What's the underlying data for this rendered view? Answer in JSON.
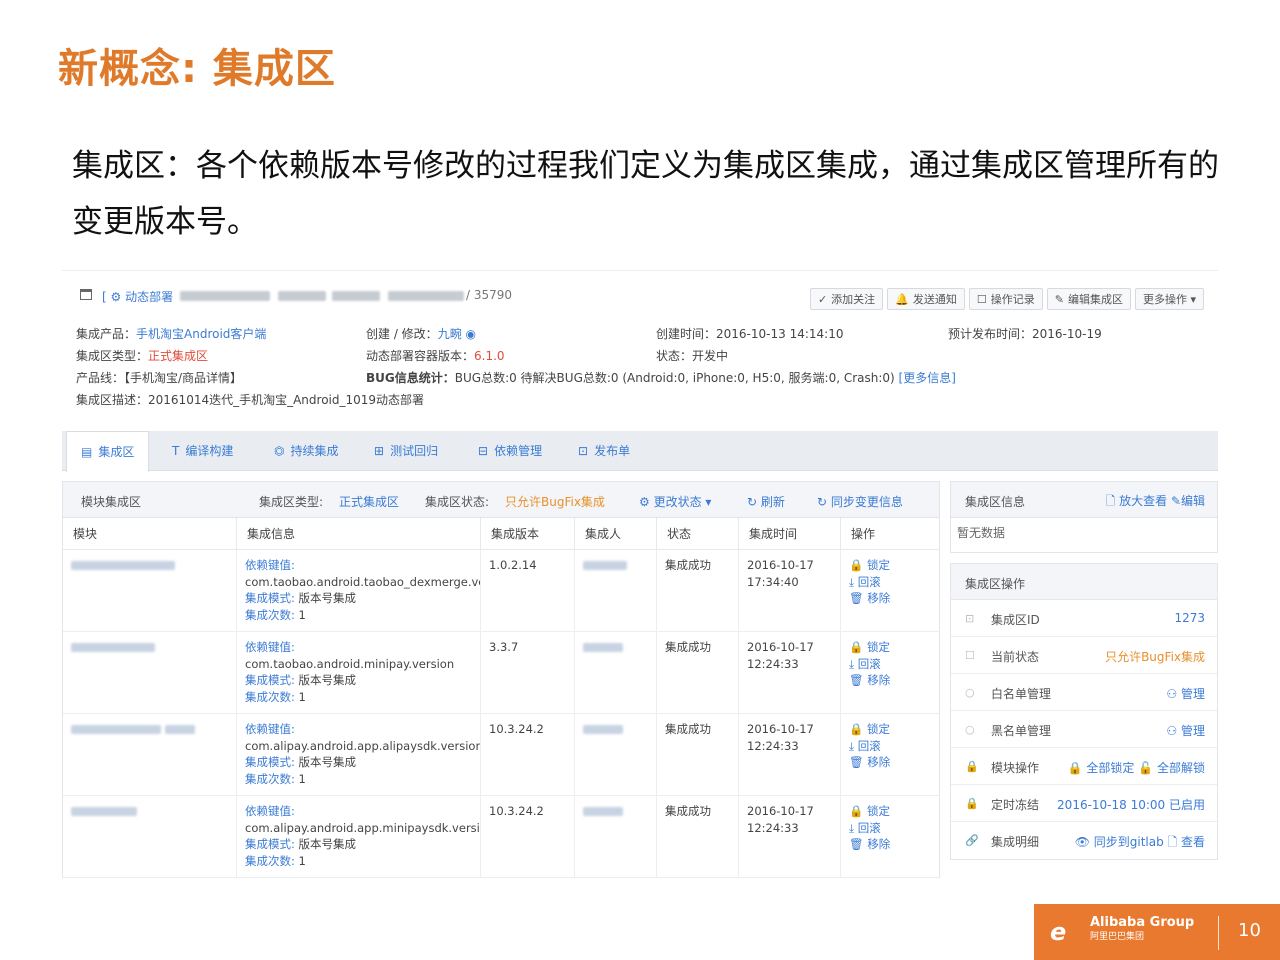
{
  "slide": {
    "title": "新概念: 集成区",
    "description": "集成区：各个依赖版本号修改的过程我们定义为集成区集成，通过集成区管理所有的变更版本号。",
    "page_number": "10",
    "brand": {
      "name": "Alibaba Group",
      "cn": "阿里巴巴集团",
      "glyph": "e"
    }
  },
  "header": {
    "breadcrumb": "[ ⚙ 动态部署",
    "id_suffix": "/ 35790",
    "buttons": [
      {
        "icon": "✓",
        "label": "添加关注"
      },
      {
        "icon": "🔔",
        "label": "发送通知"
      },
      {
        "icon": "☐",
        "label": "操作记录"
      },
      {
        "icon": "✎",
        "label": "编辑集成区"
      },
      {
        "icon": "",
        "label": "更多操作 ▾"
      }
    ]
  },
  "info": {
    "product_label": "集成产品：",
    "product": "手机淘宝Android客户端",
    "type_label": "集成区类型：",
    "type": "正式集成区",
    "line_label": "产品线：",
    "line": "【手机淘宝/商品详情】",
    "desc_label": "集成区描述：",
    "desc": "20161014迭代_手机淘宝_Android_1019动态部署",
    "creator_label": "创建 / 修改：",
    "creator": "九畹",
    "container_label": "动态部署容器版本：",
    "container": "6.1.0",
    "bug_label": "BUG信息统计：",
    "bug": "BUG总数:0   待解决BUG总数:0  (Android:0, iPhone:0, H5:0, 服务端:0, Crash:0)",
    "bug_more": "[更多信息]",
    "created_label": "创建时间：",
    "created": "2016-10-13 14:14:10",
    "status_label": "状态：",
    "status": "开发中",
    "release_label": "预计发布时间：",
    "release": "2016-10-19"
  },
  "tabs": [
    {
      "icon": "▤",
      "label": "集成区"
    },
    {
      "icon": "T",
      "label": "编译构建"
    },
    {
      "icon": "⏣",
      "label": "持续集成"
    },
    {
      "icon": "⊞",
      "label": "测试回归"
    },
    {
      "icon": "⊟",
      "label": "依赖管理"
    },
    {
      "icon": "⊡",
      "label": "发布单"
    }
  ],
  "module_panel": {
    "title": "模块集成区",
    "type_label": "集成区类型:",
    "type": "正式集成区",
    "state_label": "集成区状态:",
    "state": "只允许BugFix集成",
    "change_state": "⚙ 更改状态 ▾",
    "refresh": "↻ 刷新",
    "sync": "↻ 同步变更信息",
    "columns": [
      "模块",
      "集成信息",
      "集成版本",
      "集成人",
      "状态",
      "集成时间",
      "操作"
    ],
    "rows": [
      {
        "dep_key": "依赖键值:",
        "dep": "com.taobao.android.taobao_dexmerge.version",
        "mode_label": "集成模式:",
        "mode": "版本号集成",
        "count_label": "集成次数:",
        "count": "1",
        "version": "1.0.2.14",
        "status": "集成成功",
        "time": "2016-10-17 17:34:40"
      },
      {
        "dep_key": "依赖键值:",
        "dep": "com.taobao.android.minipay.version",
        "mode_label": "集成模式:",
        "mode": "版本号集成",
        "count_label": "集成次数:",
        "count": "1",
        "version": "3.3.7",
        "status": "集成成功",
        "time": "2016-10-17 12:24:33"
      },
      {
        "dep_key": "依赖键值:",
        "dep": "com.alipay.android.app.alipaysdk.version",
        "mode_label": "集成模式:",
        "mode": "版本号集成",
        "count_label": "集成次数:",
        "count": "1",
        "version": "10.3.24.2",
        "status": "集成成功",
        "time": "2016-10-17 12:24:33"
      },
      {
        "dep_key": "依赖键值:",
        "dep": "com.alipay.android.app.minipaysdk.version",
        "mode_label": "集成模式:",
        "mode": "版本号集成",
        "count_label": "集成次数:",
        "count": "1",
        "version": "10.3.24.2",
        "status": "集成成功",
        "time": "2016-10-17 12:24:33"
      }
    ],
    "ops": [
      "🔒 锁定",
      "⤓ 回滚",
      "🗑 移除"
    ]
  },
  "info_box": {
    "title": "集成区信息",
    "zoom": "🗋 放大查看",
    "edit": "✎编辑",
    "empty": "暂无数据"
  },
  "ops_box": {
    "title": "集成区操作",
    "rows": [
      {
        "icon": "⊡",
        "label": "集成区ID",
        "value": "1273"
      },
      {
        "icon": "☐",
        "label": "当前状态",
        "value": "只允许BugFix集成"
      },
      {
        "icon": "○",
        "label": "白名单管理",
        "value": "⚇ 管理"
      },
      {
        "icon": "○",
        "label": "黑名单管理",
        "value": "⚇ 管理"
      },
      {
        "icon": "🔒",
        "label": "模块操作",
        "value": "🔒 全部锁定  🔓 全部解锁"
      },
      {
        "icon": "🔒",
        "label": "定时冻结",
        "value": "2016-10-18 10:00  已启用"
      },
      {
        "icon": "🔗",
        "label": "集成明细",
        "value": "👁 同步到gitlab  🗋 查看"
      }
    ]
  }
}
